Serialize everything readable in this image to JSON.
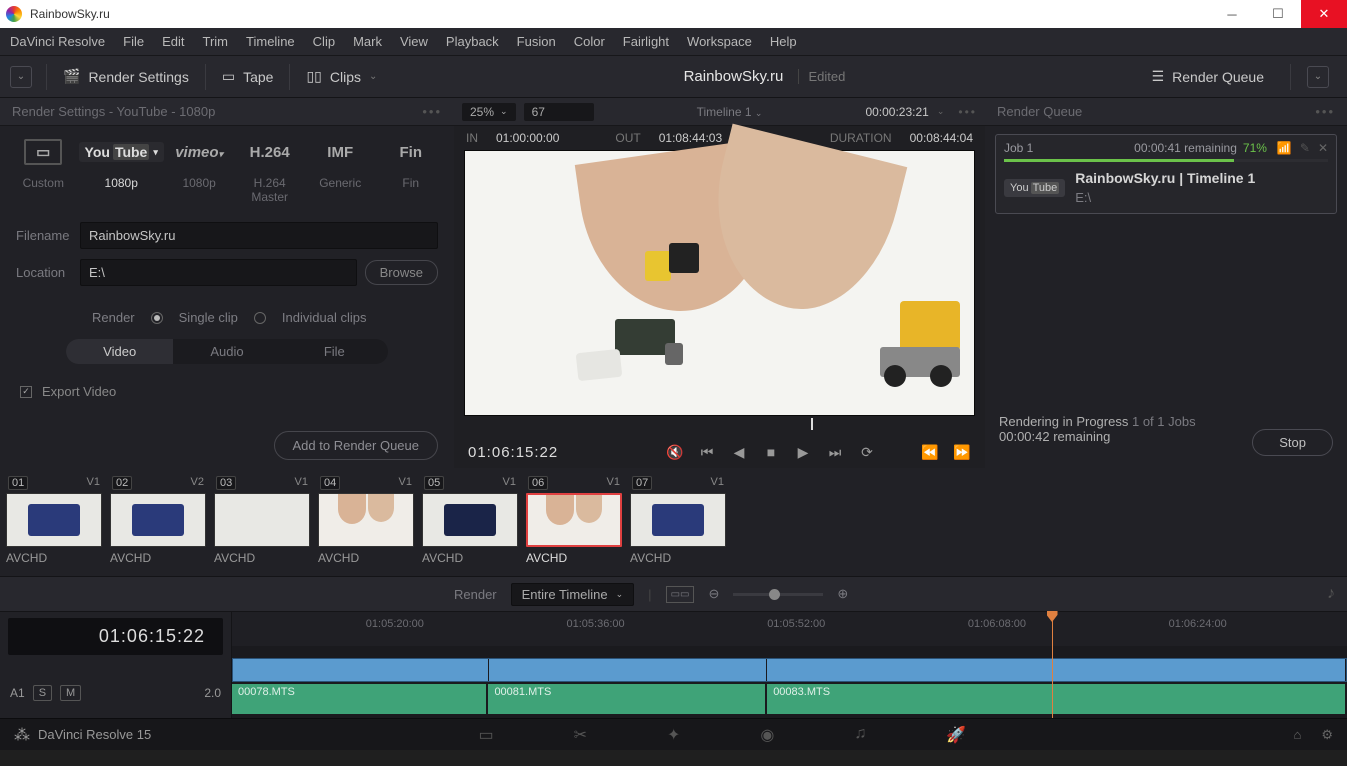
{
  "window": {
    "title": "RainbowSky.ru"
  },
  "menubar": [
    "DaVinci Resolve",
    "File",
    "Edit",
    "Trim",
    "Timeline",
    "Clip",
    "Mark",
    "View",
    "Playback",
    "Fusion",
    "Color",
    "Fairlight",
    "Workspace",
    "Help"
  ],
  "toolbar": {
    "render_settings": "Render Settings",
    "tape": "Tape",
    "clips": "Clips",
    "center_title": "RainbowSky.ru",
    "center_edited": "Edited",
    "render_queue": "Render Queue"
  },
  "left": {
    "header": "Render Settings - YouTube - 1080p",
    "presets": [
      {
        "logo": "custom",
        "label": "Custom"
      },
      {
        "logo": "youtube",
        "label": "1080p",
        "active": true
      },
      {
        "logo": "vimeo",
        "label": "1080p"
      },
      {
        "logo": "h264",
        "title": "H.264",
        "label": "H.264 Master"
      },
      {
        "logo": "imf",
        "title": "IMF",
        "label": "Generic"
      },
      {
        "logo": "final",
        "label": "Fin"
      }
    ],
    "filename_label": "Filename",
    "filename": "RainbowSky.ru",
    "location_label": "Location",
    "location": "E:\\",
    "browse": "Browse",
    "render_label": "Render",
    "single_clip": "Single clip",
    "individual": "Individual clips",
    "tabs": [
      "Video",
      "Audio",
      "File"
    ],
    "export_video": "Export Video",
    "add_btn": "Add to Render Queue"
  },
  "viewer": {
    "zoom": "25%",
    "frame": "67",
    "timeline": "Timeline 1",
    "timecode": "00:00:23:21",
    "in_label": "IN",
    "in": "01:00:00:00",
    "out_label": "OUT",
    "out": "01:08:44:03",
    "dur_label": "DURATION",
    "dur": "00:08:44:04",
    "transport_tc": "01:06:15:22"
  },
  "right": {
    "header": "Render Queue",
    "job": {
      "name": "Job 1",
      "remaining": "00:00:41 remaining",
      "percent": "71%",
      "title": "RainbowSky.ru | Timeline 1",
      "location": "E:\\"
    },
    "progress": {
      "title": "Rendering in Progress",
      "count": "1 of 1 Jobs",
      "remaining": "00:00:42 remaining",
      "stop": "Stop"
    }
  },
  "thumbs": [
    {
      "num": "01",
      "track": "V1",
      "label": "AVCHD",
      "type": "truck"
    },
    {
      "num": "02",
      "track": "V2",
      "label": "AVCHD",
      "type": "truck"
    },
    {
      "num": "03",
      "track": "V1",
      "label": "AVCHD",
      "type": "blank"
    },
    {
      "num": "04",
      "track": "V1",
      "label": "AVCHD",
      "type": "hands"
    },
    {
      "num": "05",
      "track": "V1",
      "label": "AVCHD",
      "type": "darktruck"
    },
    {
      "num": "06",
      "track": "V1",
      "label": "AVCHD",
      "type": "hands",
      "selected": true
    },
    {
      "num": "07",
      "track": "V1",
      "label": "AVCHD",
      "type": "truck"
    }
  ],
  "tlcontrols": {
    "render": "Render",
    "scope": "Entire Timeline"
  },
  "timeline": {
    "tc": "01:06:15:22",
    "a_track": "A1",
    "a_val": "2.0",
    "ruler": [
      "01:05:20:00",
      "01:05:36:00",
      "01:05:52:00",
      "01:06:08:00",
      "01:06:24:00"
    ],
    "aclips": [
      "00078.MTS",
      "00081.MTS",
      "00083.MTS"
    ]
  },
  "bottom": {
    "app": "DaVinci Resolve 15"
  }
}
